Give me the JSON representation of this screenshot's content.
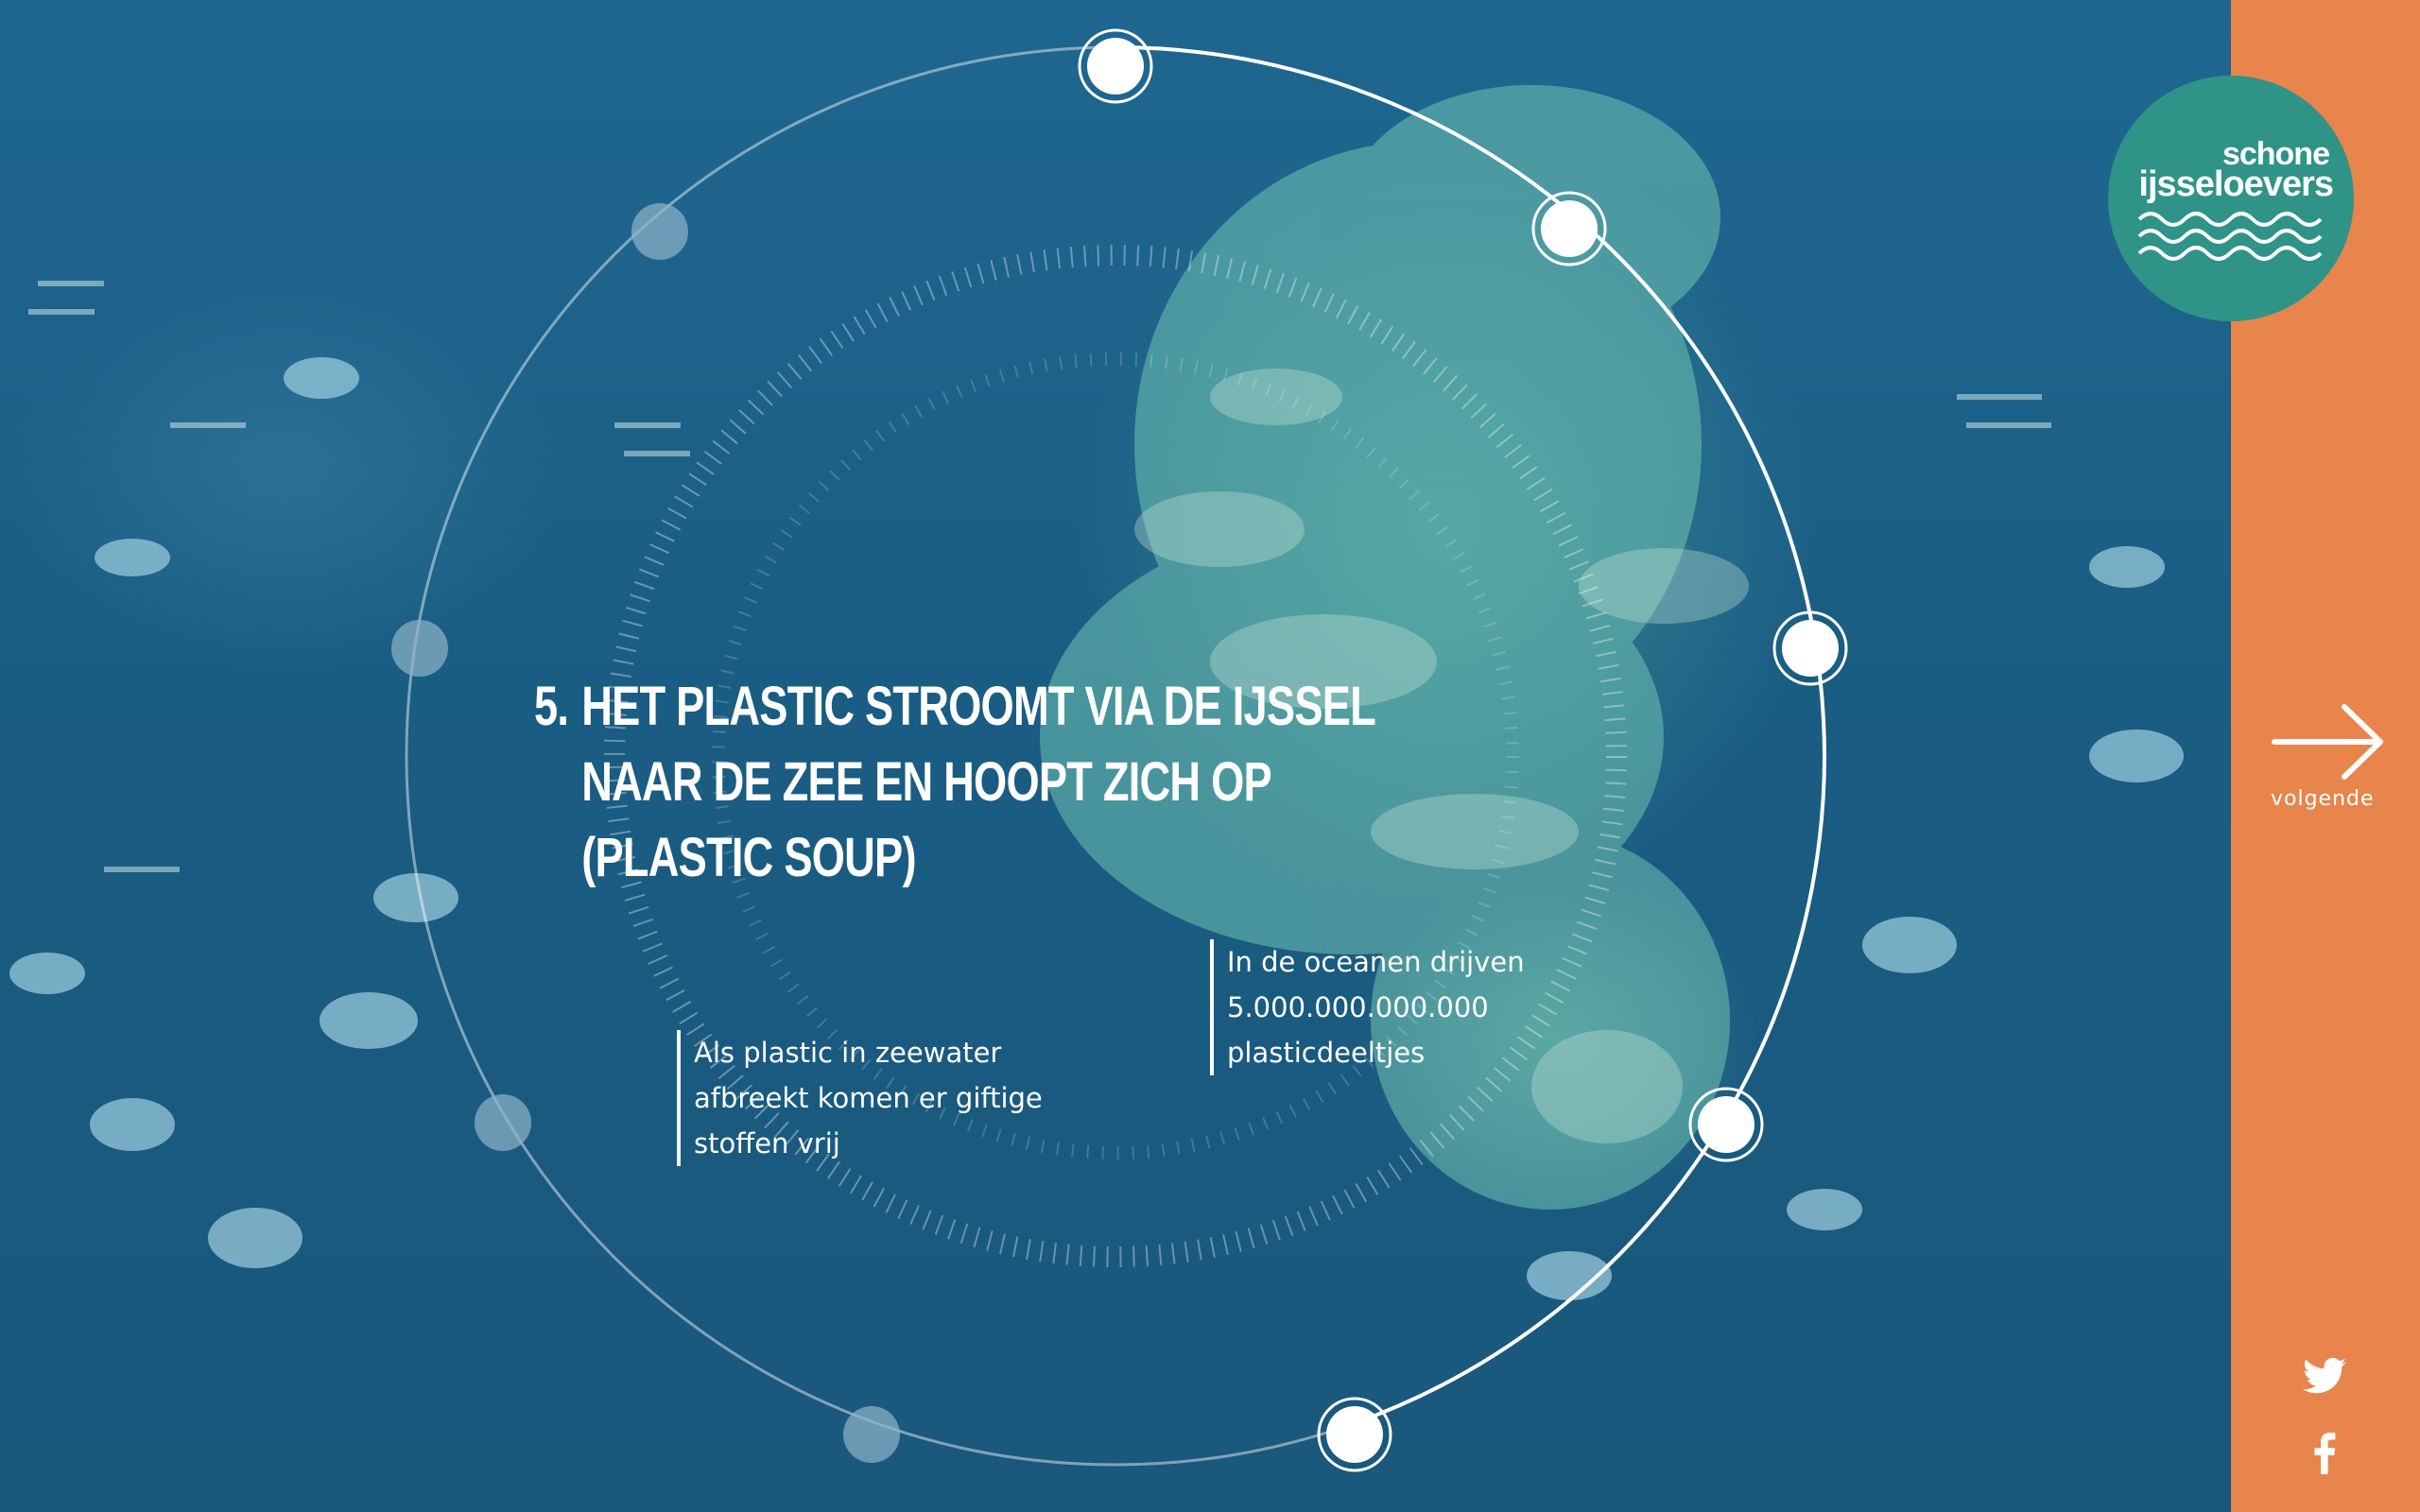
{
  "slide": {
    "number": "5.",
    "title": "HET PLASTIC STROOMT VIA DE IJSSEL NAAR DE ZEE EN HOOPT ZICH OP (PLASTIC SOUP)"
  },
  "facts": {
    "left": "Als plastic in zeewater afbreekt komen er giftige stoffen vrij",
    "right": "In de oceanen drijven 5.000.000.000.000 plasticdeeltjes"
  },
  "logo": {
    "line1": "schone",
    "line2": "ijsseloevers"
  },
  "nav": {
    "next_label": "volgende"
  },
  "progress": {
    "total_steps": 9,
    "current_step": 5
  },
  "social": {
    "icons": [
      "twitter-icon",
      "facebook-icon"
    ]
  },
  "colors": {
    "sidebar": "#e8854c",
    "logo_bg": "#2f9388",
    "water": "#1d5f85"
  }
}
